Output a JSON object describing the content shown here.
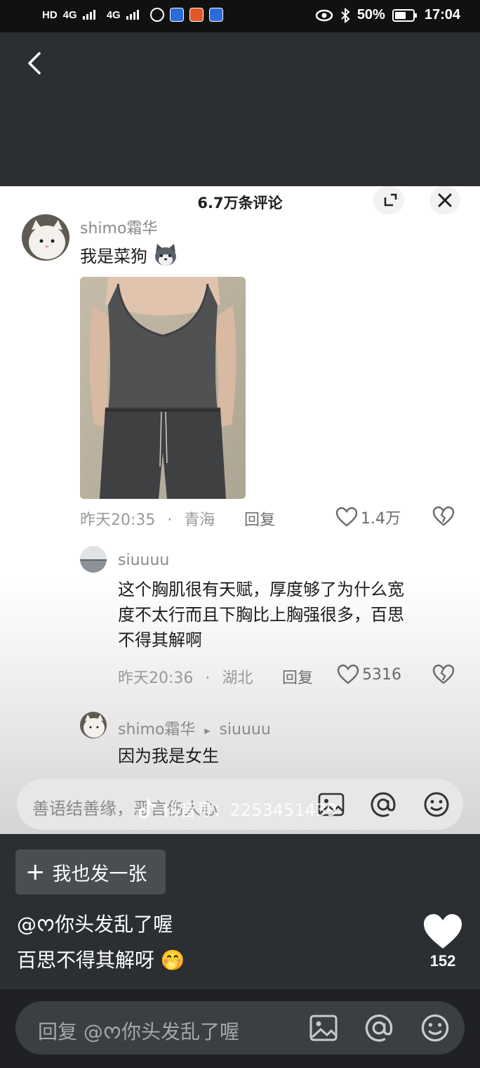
{
  "status_bar": {
    "hd": "HD",
    "network1": "4G",
    "network2": "4G",
    "battery": "50%",
    "time": "17:04"
  },
  "sheet": {
    "title": "6.7万条评论"
  },
  "comment": {
    "username": "shimo霜华",
    "text": "我是菜狗",
    "time": "昨天20:35",
    "dot": "·",
    "location": "青海",
    "reply_label": "回复",
    "likes": "1.4万"
  },
  "reply1": {
    "username": "siuuuu",
    "text_lines": [
      "这个胸肌很有天赋，厚度够了为什么宽",
      "度不太行而且下胸比上胸强很多，百思",
      "不得其解啊"
    ],
    "time": "昨天20:36",
    "dot": "·",
    "location": "湖北",
    "reply_label": "回复",
    "likes": "5316"
  },
  "reply2": {
    "username": "shimo霜华",
    "arrow": "▸",
    "target": "siuuuu",
    "text": "因为我是女生"
  },
  "sheet_input": {
    "placeholder": "善语结善缘，恶言伤人心"
  },
  "watermark": "抖音号：2253451439",
  "post_button": {
    "plus": "+",
    "label": "我也发一张"
  },
  "caption": {
    "line1": "@ᰔ你头发乱了喔",
    "line2": "百思不得其解呀",
    "emoji": "🤭"
  },
  "like_count": "152",
  "reply_input": {
    "placeholder": "回复 @ᰔ你头发乱了喔"
  },
  "colors": {
    "dark_bg": "#2b2e33",
    "sheet_bg": "#ffffff",
    "accent_text": "#ffffff"
  }
}
